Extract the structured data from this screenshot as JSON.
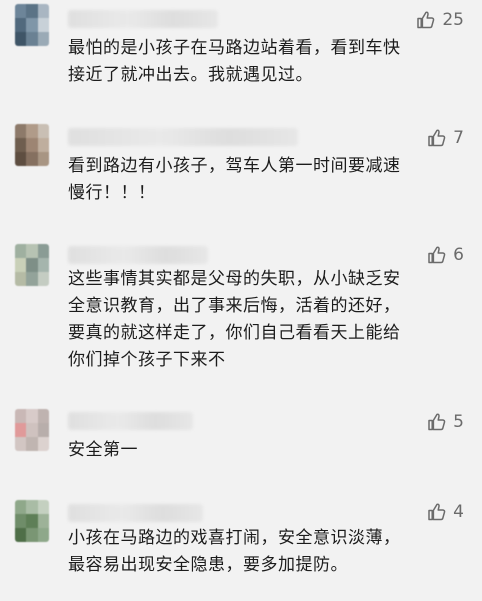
{
  "comments": [
    {
      "likes": "25",
      "text": "最怕的是小孩子在马路边站着看，看到车快\n接近了就冲出去。我就遇见过。"
    },
    {
      "likes": "7",
      "text": "看到路边有小孩子，驾车人第一时间要减速\n慢行！！！"
    },
    {
      "likes": "6",
      "text": "这些事情其实都是父母的失职，从小缺乏安\n全意识教育，出了事来后悔，活着的还好，\n要真的就这样走了，你们自己看看天上能给\n你们掉个孩子下来不"
    },
    {
      "likes": "5",
      "text": "安全第一"
    },
    {
      "likes": "4",
      "text": "小孩在马路边的戏喜打闹，安全意识淡薄，\n最容易出现安全隐患，要多加提防。"
    }
  ],
  "icons": {
    "like": "thumbs-up-icon"
  },
  "colors": {
    "background": "#f2f2f2",
    "text": "#1c1c1c",
    "like": "#6b6b6b"
  }
}
